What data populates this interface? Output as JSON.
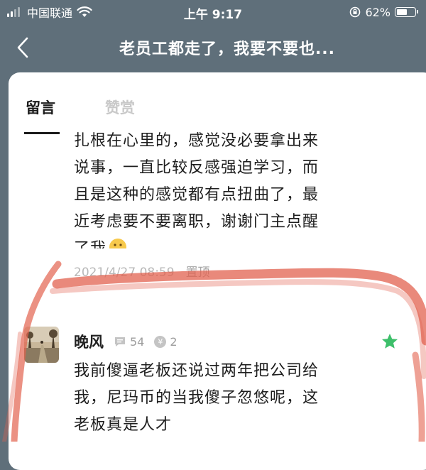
{
  "status_bar": {
    "carrier": "中国联通",
    "time": "上午 9:17",
    "battery": "62%",
    "battery_level": 0.62
  },
  "nav": {
    "title": "老员工都走了，我要不要也..."
  },
  "tabs": [
    {
      "label": "留言",
      "active": true
    },
    {
      "label": "赞赏",
      "active": false
    }
  ],
  "message1": {
    "lines": [
      "扎根在心里的，感觉没必要拿出来",
      "说事，一直比较反感强迫学习，而",
      "且是这种的感觉都有点扭曲了，最",
      "近考虑要不要离职，谢谢门主点醒",
      "了我"
    ],
    "emoji": "thinking-face",
    "timestamp": "2021/4/27 08:59",
    "pin_label": "置顶"
  },
  "comment": {
    "username": "晚风",
    "comment_count": "54",
    "coin_symbol": "¥",
    "coin_count": "2",
    "lines": [
      "我前傻逼老板还说过两年把公司给",
      "我，尼玛币的当我傻子忽悠呢，这",
      "老板真是人才"
    ]
  },
  "colors": {
    "header_bg": "#5f6f7a",
    "star": "#3dbf6a",
    "highlight": "#e2624f"
  }
}
